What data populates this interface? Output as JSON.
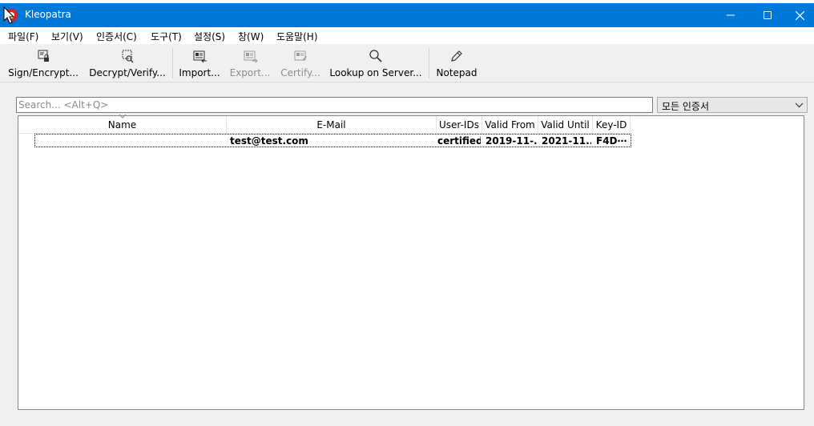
{
  "window": {
    "title": "Kleopatra"
  },
  "menu": [
    "파일(F)",
    "보기(V)",
    "인증서(C)",
    "도구(T)",
    "설정(S)",
    "창(W)",
    "도움말(H)"
  ],
  "toolbar": {
    "sign_encrypt": "Sign/Encrypt...",
    "decrypt_verify": "Decrypt/Verify...",
    "import": "Import...",
    "export": "Export...",
    "certify": "Certify...",
    "lookup": "Lookup on Server...",
    "notepad": "Notepad"
  },
  "search": {
    "placeholder": "Search... <Alt+Q>",
    "value": ""
  },
  "filter": {
    "selected": "모든 인증서"
  },
  "table": {
    "columns": [
      "Name",
      "E-Mail",
      "User-IDs",
      "Valid From",
      "Valid Until",
      "Key-ID"
    ],
    "rows": [
      {
        "name": "",
        "email": "test@test.com",
        "user_ids": "certified",
        "valid_from": "2019-11-...",
        "valid_until": "2021-11...",
        "key_id": "F4D⋯"
      }
    ]
  },
  "colors": {
    "titlebar": "#0078d7",
    "window_bg": "#f0f0f0"
  }
}
